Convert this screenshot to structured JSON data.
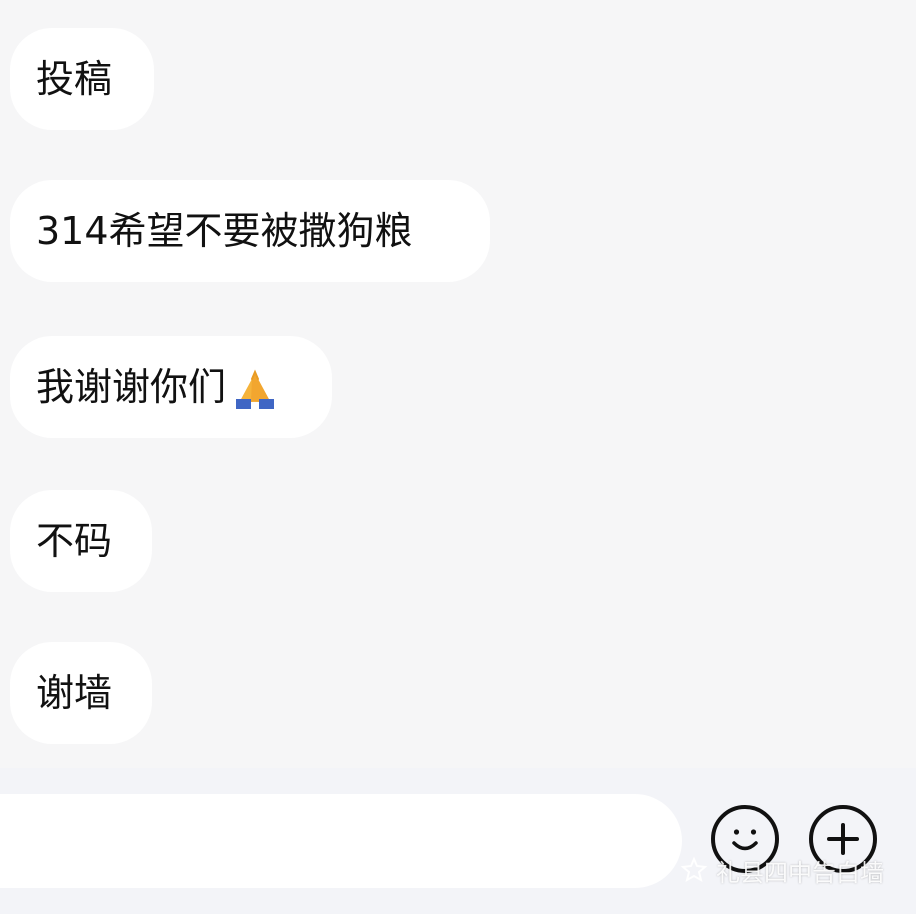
{
  "messages": [
    {
      "text": "投稿"
    },
    {
      "text": "314希望不要被撒狗粮"
    },
    {
      "text": "我谢谢你们",
      "emoji": "folded-hands"
    },
    {
      "text": "不码"
    },
    {
      "text": "谢墙"
    }
  ],
  "composer": {
    "input_value": "",
    "emoji_icon": "smiley-face-icon",
    "plus_icon": "plus-circle-icon"
  },
  "watermark": {
    "text": "礼县四中告白墙",
    "icon": "watermark-logo-icon"
  },
  "colors": {
    "background": "#f6f6f7",
    "bubble": "#ffffff",
    "text": "#111111",
    "composer_bar": "#f3f4f8",
    "emoji_skin": "#f5b33b",
    "emoji_sleeve": "#3f66c4"
  }
}
